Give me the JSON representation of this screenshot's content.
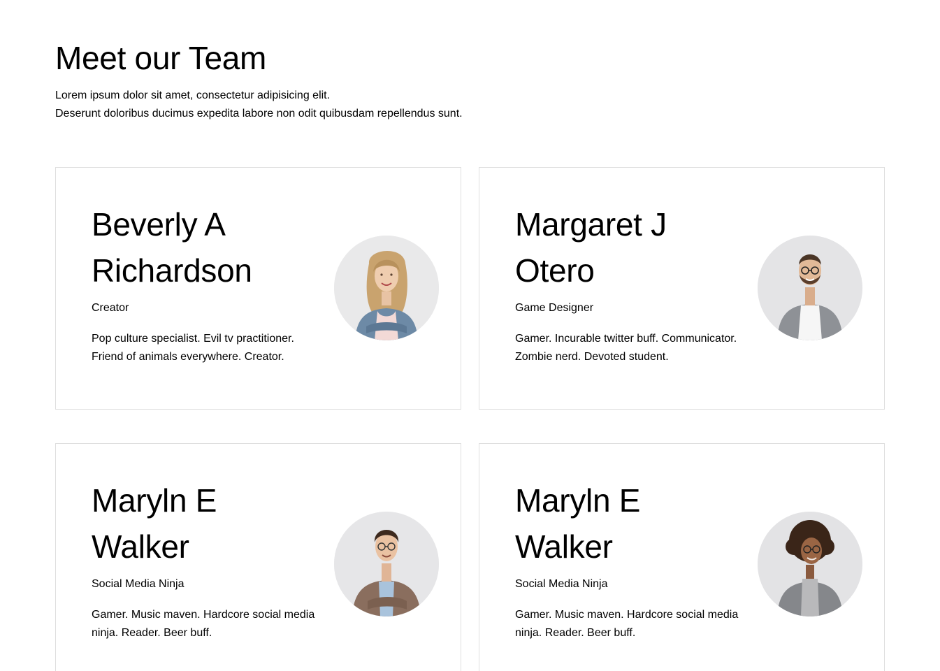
{
  "header": {
    "title": "Meet our Team",
    "intro_line1": "Lorem ipsum dolor sit amet, consectetur adipisicing elit.",
    "intro_line2": "Deserunt doloribus ducimus expedita labore non odit quibusdam repellendus sunt."
  },
  "team": [
    {
      "name_line1": "Beverly A",
      "name_line2": "Richardson",
      "role": "Creator",
      "bio_line1": "Pop culture specialist. Evil tv practitioner.",
      "bio_line2": "Friend of animals everywhere. Creator.",
      "avatar": "woman-blonde-denim-jacket-photo"
    },
    {
      "name_line1": "Margaret J",
      "name_line2": "Otero",
      "role": "Game Designer",
      "bio_line1": "Gamer. Incurable twitter buff. Communicator.",
      "bio_line2": "Zombie nerd. Devoted student.",
      "avatar": "man-glasses-grey-blazer-photo"
    },
    {
      "name_line1": "Maryln E",
      "name_line2": "Walker",
      "role": "Social Media Ninja",
      "bio_line1": "Gamer. Music maven. Hardcore social media",
      "bio_line2": "ninja. Reader. Beer buff.",
      "avatar": "man-glasses-checked-blazer-photo"
    },
    {
      "name_line1": "Maryln E",
      "name_line2": "Walker",
      "role": "Social Media Ninja",
      "bio_line1": "Gamer. Music maven. Hardcore social media",
      "bio_line2": "ninja. Reader. Beer buff.",
      "avatar": "woman-curly-hair-grey-blazer-photo"
    }
  ],
  "colors": {
    "card_border": "#dedede",
    "text": "#000000",
    "background": "#ffffff",
    "avatar_bg": "#e6e6e6"
  }
}
